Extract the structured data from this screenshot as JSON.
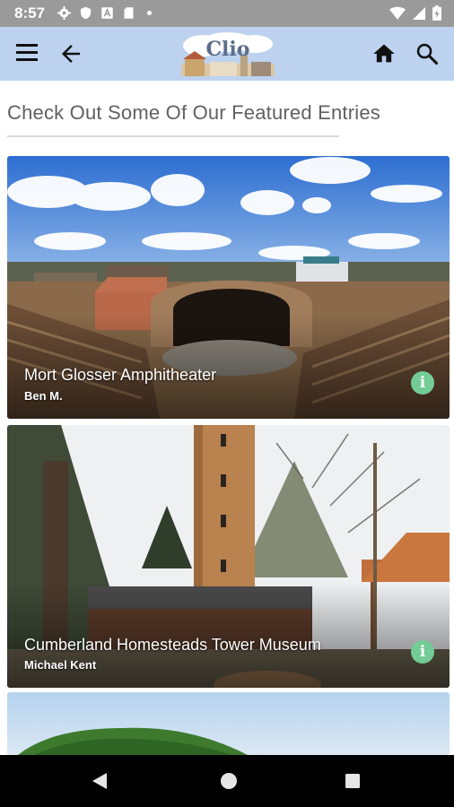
{
  "status_bar": {
    "time": "8:57",
    "icons": [
      "settings-icon",
      "shield-icon",
      "text-a-icon",
      "sd-card-icon",
      "notification-dot",
      "wifi-icon",
      "signal-icon",
      "battery-icon"
    ]
  },
  "app_bar": {
    "logo_text": "Clio",
    "background": "#bcd2ef",
    "icons": [
      "menu-icon",
      "arrow-left-icon",
      "home-icon",
      "search-icon"
    ]
  },
  "main": {
    "heading": "Check Out Some Of Our Featured Entries",
    "entries": [
      {
        "title": "Mort Glosser Amphitheater",
        "author": "Ben M.",
        "info_icon": "info-icon"
      },
      {
        "title": "Cumberland Homesteads Tower Museum",
        "author": "Michael Kent",
        "info_icon": "info-icon"
      },
      {
        "title": "",
        "author": ""
      }
    ]
  },
  "nav_bar": {
    "buttons": [
      "back-triangle-icon",
      "home-circle-icon",
      "recents-square-icon"
    ]
  },
  "colors": {
    "accent_info": "#73cc95",
    "heading_text": "#616161",
    "status_bar": "#9a9a9a"
  }
}
